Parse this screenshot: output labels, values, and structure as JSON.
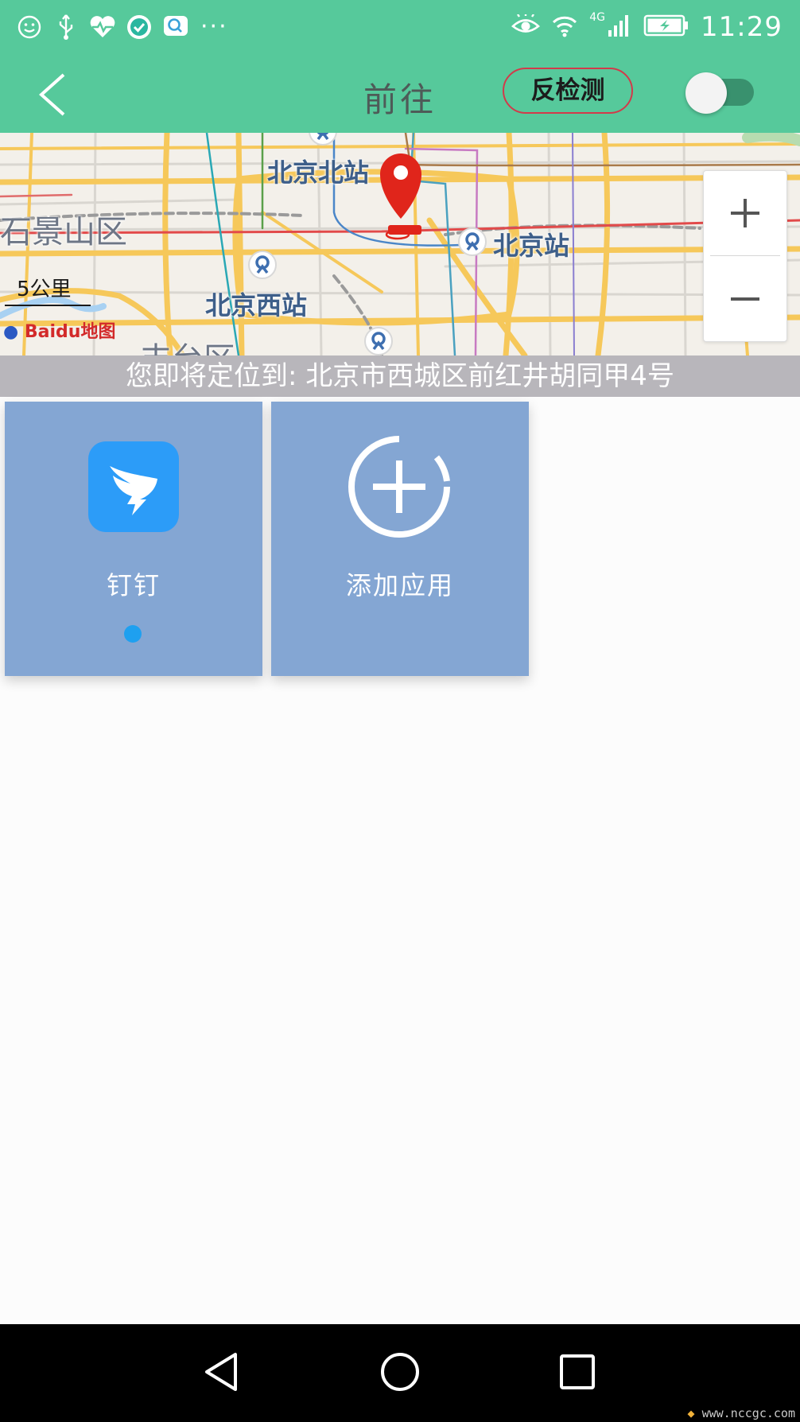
{
  "status_bar": {
    "network": "4G",
    "time": "11:29",
    "more": "···",
    "icons": [
      "smiley-icon",
      "usb-icon",
      "health-icon",
      "check-app-icon",
      "message-icon",
      "eye-icon",
      "wifi-icon",
      "signal-icon",
      "battery-charging-icon"
    ]
  },
  "header": {
    "title": "前往",
    "anti_detect_label": "反检测",
    "toggle_on": false
  },
  "map": {
    "labels": {
      "beijing_north": "北京北站",
      "beijing_station": "北京站",
      "beijing_west": "北京西站",
      "shijingshan": "石景山区",
      "fengtai": "丰台区"
    },
    "scale_text": "5公里",
    "logo_text": "Baidu地图",
    "zoom_in": "+",
    "zoom_out": "−"
  },
  "location_banner": "您即将定位到: 北京市西城区前红井胡同甲4号",
  "apps": [
    {
      "label": "钉钉",
      "has_indicator": true
    },
    {
      "label": "添加应用"
    }
  ],
  "watermark": "www.nccgc.com",
  "colors": {
    "primary": "#56c99b",
    "tile": "#84a6d3",
    "dingtalk": "#2c9cf8",
    "pin": "#e0251b",
    "banner": "#b8b6bb"
  }
}
